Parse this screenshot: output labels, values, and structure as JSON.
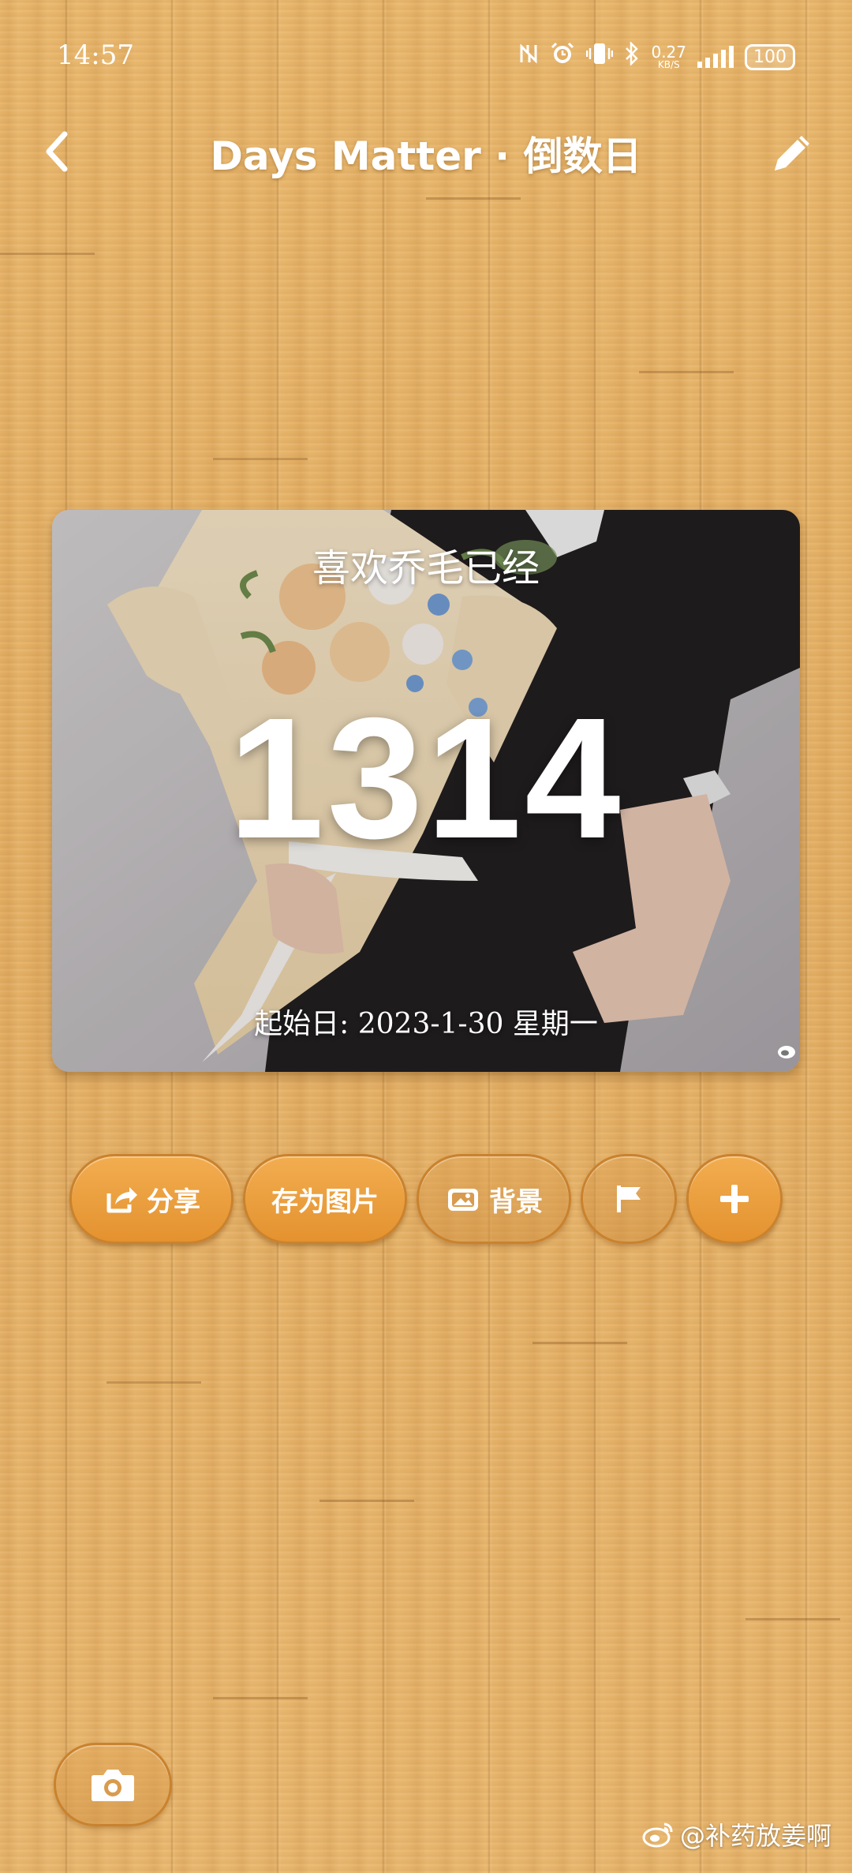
{
  "status_bar": {
    "time": "14:57",
    "net_speed_value": "0.27",
    "net_speed_unit": "KB/S",
    "battery": "100",
    "icons": [
      "nfc-icon",
      "alarm-icon",
      "vibrate-icon",
      "bluetooth-icon",
      "signal-icon",
      "battery-icon"
    ]
  },
  "nav": {
    "title": "Days Matter · 倒数日",
    "back_icon": "chevron-left-icon",
    "edit_icon": "pencil-icon"
  },
  "card": {
    "title": "喜欢乔毛已经",
    "count": "1314",
    "date_line": "起始日: 2023-1-30 星期一"
  },
  "actions": {
    "share_label": "分享",
    "save_image_label": "存为图片",
    "background_label": "背景",
    "flag_icon": "flag-icon",
    "add_icon": "plus-icon"
  },
  "camera_icon": "camera-icon",
  "watermark": {
    "text": "@补药放姜啊",
    "icon": "weibo-icon"
  },
  "colors": {
    "accent": "#e99a36",
    "accent_border": "#c9822e",
    "wood": "#e6b46c",
    "text": "#ffffff"
  }
}
